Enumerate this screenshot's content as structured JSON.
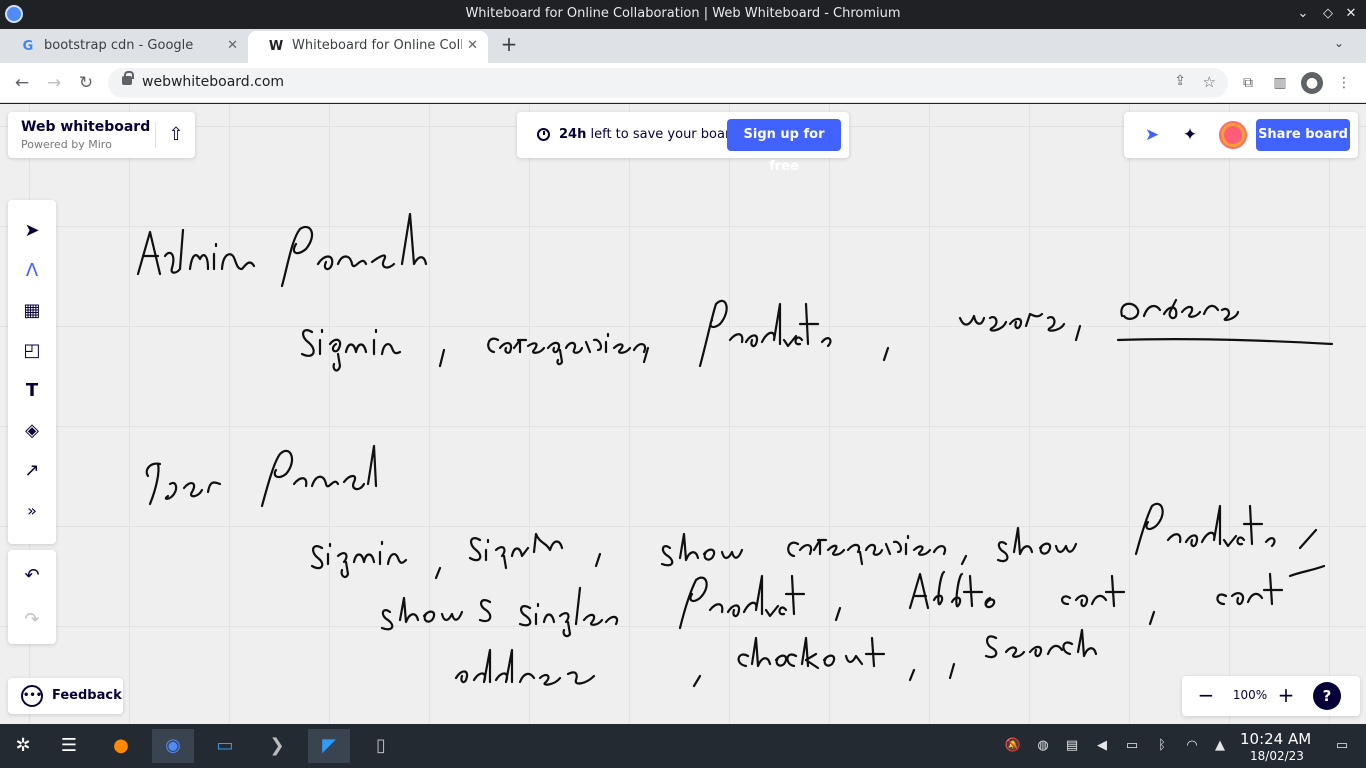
{
  "window": {
    "title": "Whiteboard for Online Collaboration | Web Whiteboard - Chromium"
  },
  "tabs": [
    {
      "label": "bootstrap cdn - Google Search",
      "favicon": "G"
    },
    {
      "label": "Whiteboard for Online Collaboration",
      "favicon": "W"
    }
  ],
  "address": {
    "url": "webwhiteboard.com"
  },
  "board": {
    "brand_name": "Web whiteboard",
    "brand_sub": "Powered by Miro",
    "save_bold": "24h",
    "save_rest": " left to save your board.",
    "signup_label": "Sign up for free",
    "share_label": "Share board",
    "feedback_label": "Feedback",
    "zoom_value": "100%",
    "help_label": "?"
  },
  "handwriting": [
    "Admin panel",
    "Signin, categories, products, users, orders",
    "User panel",
    "Signin, signup, show categories, show products,",
    "show single product, Add to cart, cart",
    "address, checkout, search"
  ],
  "taskbar": {
    "time": "10:24 AM",
    "date": "18/02/23"
  },
  "icons": [
    "chromium-icon",
    "google-icon",
    "whiteboard-favicon",
    "upload-icon",
    "clock-icon",
    "cursor-tracking-icon",
    "celebrate-icon",
    "select-icon",
    "pen-icon",
    "template-icon",
    "sticky-note-icon",
    "text-icon",
    "shapes-icon",
    "arrow-icon",
    "more-icon",
    "undo-icon",
    "redo-icon",
    "feedback-icon"
  ]
}
